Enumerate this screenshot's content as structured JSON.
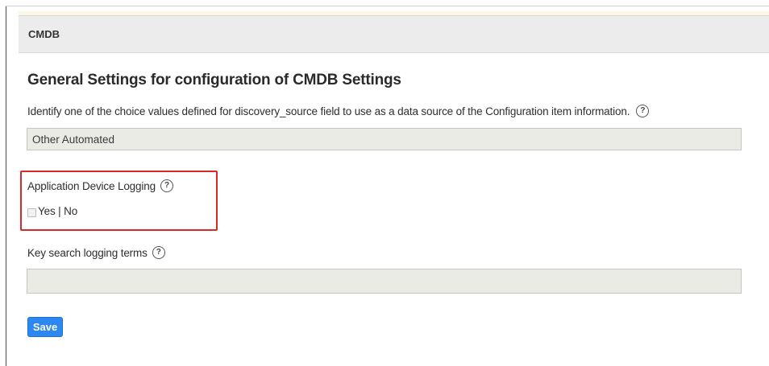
{
  "header": {
    "title": "CMDB"
  },
  "section": {
    "title": "General Settings for configuration of CMDB Settings"
  },
  "discovery_source": {
    "label": "Identify one of the choice values defined for discovery_source field to use as a data source of the Configuration item information.",
    "value": "Other Automated"
  },
  "app_device_logging": {
    "label": "Application Device Logging",
    "checked": false,
    "toggle_text": "Yes | No"
  },
  "key_search": {
    "label": "Key search logging terms",
    "value": ""
  },
  "help_glyph": "?",
  "save_label": "Save",
  "colors": {
    "accent": "#2d87f0",
    "highlight": "#d62a2a",
    "header_bg": "#ececec",
    "field_bg": "#ebebe6"
  }
}
